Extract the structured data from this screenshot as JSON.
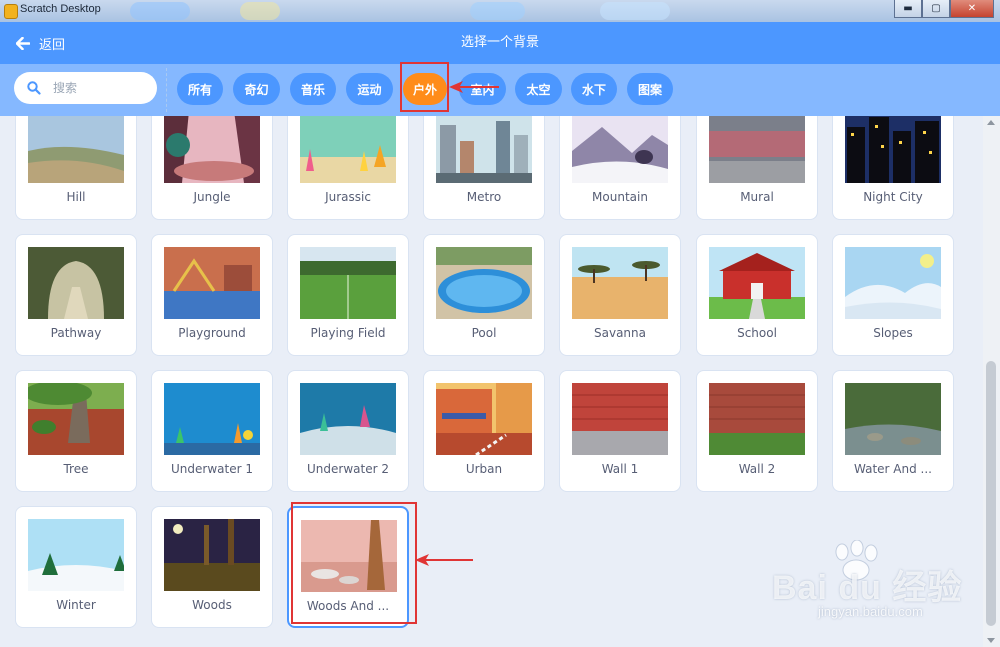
{
  "window": {
    "title": "Scratch Desktop",
    "minimize": "▬",
    "maximize": "▢",
    "close": "✕"
  },
  "header": {
    "back_label": "返回",
    "title": "选择一个背景"
  },
  "search": {
    "placeholder": "搜索",
    "value": ""
  },
  "tags": [
    {
      "label": "所有",
      "active": false
    },
    {
      "label": "奇幻",
      "active": false
    },
    {
      "label": "音乐",
      "active": false
    },
    {
      "label": "运动",
      "active": false
    },
    {
      "label": "户外",
      "active": true
    },
    {
      "label": "室内",
      "active": false
    },
    {
      "label": "太空",
      "active": false
    },
    {
      "label": "水下",
      "active": false
    },
    {
      "label": "图案",
      "active": false
    }
  ],
  "backdrops": {
    "row1": [
      "Hill",
      "Jungle",
      "Jurassic",
      "Metro",
      "Mountain",
      "Mural",
      "Night City"
    ],
    "row2": [
      "Pathway",
      "Playground",
      "Playing Field",
      "Pool",
      "Savanna",
      "School",
      "Slopes"
    ],
    "row3": [
      "Tree",
      "Underwater 1",
      "Underwater 2",
      "Urban",
      "Wall 1",
      "Wall 2",
      "Water And ..."
    ],
    "row4": [
      "Winter",
      "Woods",
      "Woods And ..."
    ]
  },
  "colors": {
    "header": "#4c97ff",
    "filter_bar": "#85b8ff",
    "active_tag": "#ff8c1a",
    "annotation": "#e03535"
  },
  "watermark": {
    "brand": "Bai du 经验",
    "url": "jingyan.baidu.com"
  }
}
